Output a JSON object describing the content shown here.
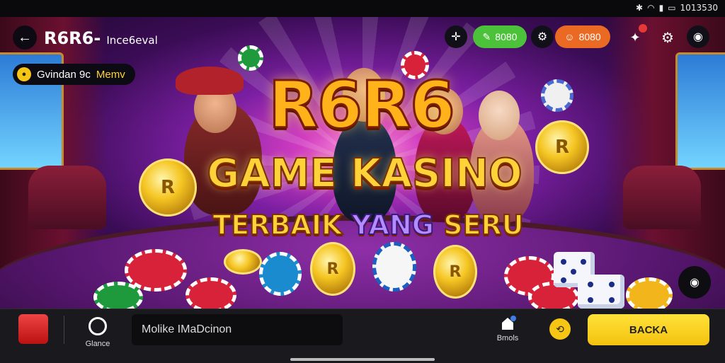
{
  "status_bar": {
    "right_text": "1013530"
  },
  "header": {
    "back_icon": "arrow-left-icon",
    "app_name": "R6R6-",
    "app_sub": "Ince6eval",
    "pill_text_a": "Gvindan 9c",
    "pill_text_b": "Memv",
    "green_pill": "8080",
    "orange_pill": "8080"
  },
  "banner": {
    "logo": "R6R6",
    "headline_line1": "GAME KASINO",
    "headline_line2_a": "TERBAIK",
    "headline_line2_b": "YANG",
    "headline_line2_c": "SERU"
  },
  "bottom_bar": {
    "game_chip_label": "Glance",
    "search_text": "Molike IMaDcinon",
    "basket_label": "Bmols",
    "cta_label": "BACKA"
  },
  "colors": {
    "accent_yellow": "#f4c20d",
    "green": "#4cc23b",
    "orange": "#ea6a24"
  }
}
